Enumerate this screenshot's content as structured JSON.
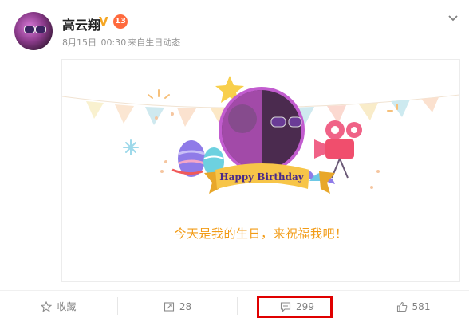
{
  "post": {
    "username": "高云翔",
    "level": "13",
    "date": "8月15日",
    "time": "00:30",
    "source": "来自生日动态"
  },
  "card": {
    "banner_text": "Happy Birthday",
    "message": "今天是我的生日，来祝福我吧！"
  },
  "footer": {
    "favorite_label": "收藏",
    "repost_count": "28",
    "comment_count": "299",
    "like_count": "581"
  },
  "colors": {
    "accent_orange": "#f29b16",
    "banner_yellow": "#f7c548",
    "highlight_red": "#e00000"
  },
  "icons": [
    "chevron-down-icon",
    "verified-v-icon",
    "star-icon",
    "repost-icon",
    "comment-icon",
    "like-icon"
  ]
}
